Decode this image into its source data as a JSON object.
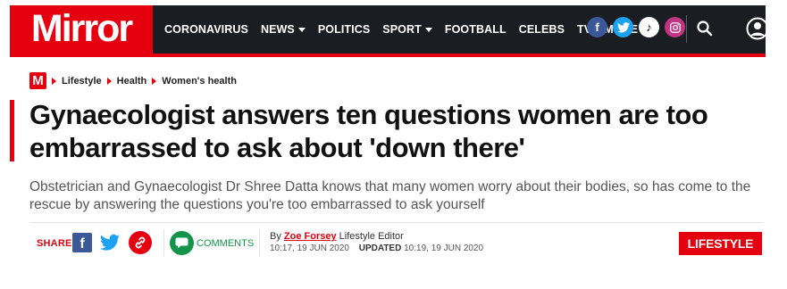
{
  "brand": {
    "logo": "Mirror",
    "accent_color": "#e4000f",
    "nav_bg": "#1a1d21"
  },
  "nav": {
    "items": [
      {
        "label": "CORONAVIRUS",
        "dropdown": false
      },
      {
        "label": "NEWS",
        "dropdown": true
      },
      {
        "label": "POLITICS",
        "dropdown": false
      },
      {
        "label": "SPORT",
        "dropdown": true
      },
      {
        "label": "FOOTBALL",
        "dropdown": false
      },
      {
        "label": "CELEBS",
        "dropdown": false
      },
      {
        "label": "TV",
        "dropdown": false
      },
      {
        "label": "MORE",
        "dropdown": true
      }
    ],
    "social": {
      "facebook": "f",
      "tiktok": "♪"
    }
  },
  "breadcrumb": {
    "badge": "M",
    "items": [
      "Lifestyle",
      "Health",
      "Women's health"
    ]
  },
  "article": {
    "headline": "Gynaecologist answers ten questions women are too embarrassed to ask about 'down there'",
    "standfirst": "Obstetrician and Gynaecologist Dr Shree Datta knows that many women worry about their bodies, so has come to the rescue by answering the questions you're too embarrassed to ask yourself",
    "byline_prefix": "By",
    "author": "Zoe Forsey",
    "author_role": "Lifestyle Editor",
    "published": "10:17, 19 JUN 2020",
    "updated_label": "UPDATED",
    "updated": "10:19, 19 JUN 2020",
    "section_tag": "LIFESTYLE"
  },
  "share": {
    "label": "SHARE",
    "comments_label": "COMMENTS"
  }
}
